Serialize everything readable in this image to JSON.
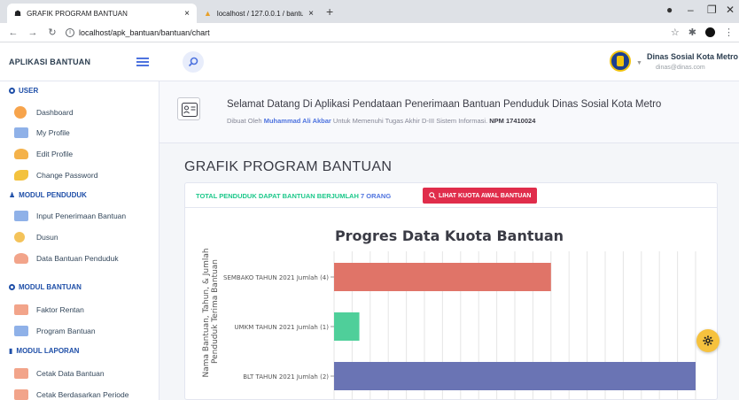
{
  "browser": {
    "tabs": [
      {
        "title": "GRAFIK PROGRAM BANTUAN",
        "close": "×"
      },
      {
        "title": "localhost / 127.0.0.1 / bantuan / …",
        "close": "×"
      }
    ],
    "new_tab": "+",
    "url": "localhost/apk_bantuan/bantuan/chart"
  },
  "app": {
    "brand": "APLIKASI BANTUAN",
    "user_name": "Dinas Sosial Kota Metro",
    "user_email": "dinas@dinas.com"
  },
  "sidebar": {
    "sections": [
      {
        "label": "USER",
        "icon": "circle-icon",
        "items": [
          "Dashboard",
          "My Profile",
          "Edit Profile",
          "Change Password"
        ]
      },
      {
        "label": "MODUL PENDUDUK",
        "icon": "users-icon",
        "items": [
          "Input Penerimaan Bantuan",
          "Dusun",
          "Data Bantuan Penduduk"
        ]
      },
      {
        "label": "MODUL BANTUAN",
        "icon": "circle-icon",
        "items": [
          "Faktor Rentan",
          "Program Bantuan"
        ]
      },
      {
        "label": "MODUL LAPORAN",
        "icon": "book-icon",
        "items": [
          "Cetak Data Bantuan",
          "Cetak Berdasarkan Periode"
        ]
      }
    ]
  },
  "welcome": {
    "title": "Selamat Datang Di Aplikasi Pendataan Penerimaan Bantuan Penduduk Dinas Sosial Kota Metro",
    "sub_prefix": "Dibuat Oleh",
    "author": "Muhammad Ali Akbar",
    "sub_middle": "Untuk Memenuhi Tugas Akhir D-III Sistem Informasi.",
    "npm": "NPM 17410024"
  },
  "page": {
    "title": "GRAFIK PROGRAM BANTUAN",
    "total_prefix": "TOTAL PENDUDUK DAPAT BANTUAN BERJUMLAH",
    "total_count": "7 ORANG",
    "quota_button": "LIHAT KUOTA AWAL BANTUAN"
  },
  "colors": {
    "sembako": "#e07468",
    "umkm": "#4fcf9a",
    "blt": "#6a74b4"
  },
  "chart_data": {
    "type": "bar",
    "orientation": "horizontal",
    "title": "Progres Data Kuota Bantuan",
    "ylabel": "Nama Bantuan, Tahun, & Jumlah Penduduk Terima Bantuan",
    "categories": [
      "SEMBAKO TAHUN 2021 Jumlah (4)",
      "UMKM TAHUN 2021 Jumlah (1)",
      "BLT TAHUN 2021 Jumlah (2)"
    ],
    "values": [
      60,
      7,
      100
    ],
    "xlim": [
      0,
      100
    ],
    "grid": true,
    "legend": "none"
  }
}
